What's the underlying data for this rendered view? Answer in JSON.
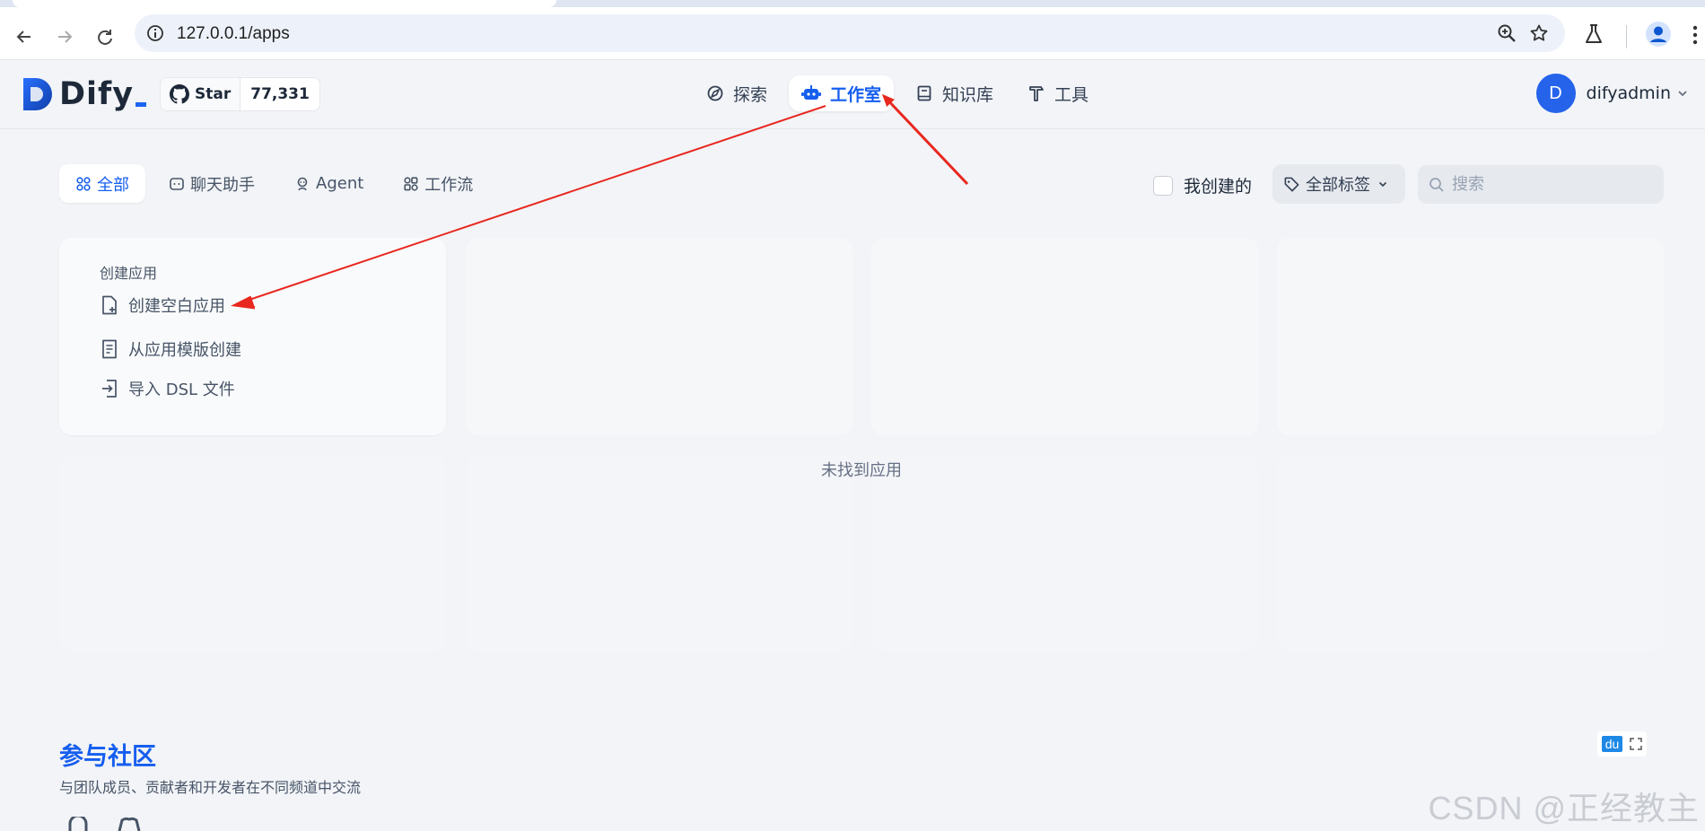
{
  "browser": {
    "url": "127.0.0.1/apps"
  },
  "header": {
    "logo_text": "Dify",
    "github": {
      "star_label": "Star",
      "star_count": "77,331"
    },
    "nav": [
      {
        "label": "探索",
        "icon": "explore-icon"
      },
      {
        "label": "工作室",
        "icon": "robot-icon",
        "active": true
      },
      {
        "label": "知识库",
        "icon": "book-icon"
      },
      {
        "label": "工具",
        "icon": "hammer-icon"
      }
    ],
    "user": {
      "avatar_letter": "D",
      "name": "difyadmin"
    }
  },
  "filters": {
    "tabs": [
      {
        "label": "全部",
        "icon": "grid-icon",
        "active": true
      },
      {
        "label": "聊天助手",
        "icon": "chat-icon"
      },
      {
        "label": "Agent",
        "icon": "agent-icon"
      },
      {
        "label": "工作流",
        "icon": "workflow-icon"
      }
    ],
    "mine_label": "我创建的",
    "tags_label": "全部标签",
    "search_placeholder": "搜索"
  },
  "create_card": {
    "title": "创建应用",
    "options": [
      {
        "label": "创建空白应用",
        "icon": "blank-app-icon"
      },
      {
        "label": "从应用模版创建",
        "icon": "template-icon"
      },
      {
        "label": "导入 DSL 文件",
        "icon": "import-icon"
      }
    ]
  },
  "empty_message": "未找到应用",
  "community": {
    "title": "参与社区",
    "description": "与团队成员、贡献者和开发者在不同频道中交流"
  },
  "overlay": {
    "du_label": "du",
    "watermark": "CSDN @正经教主",
    "annotation_color": "#e8271f"
  },
  "colors": {
    "accent": "#155eef",
    "background": "#f2f4f7"
  }
}
